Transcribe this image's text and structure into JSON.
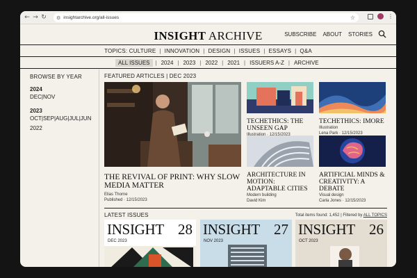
{
  "browser": {
    "url": "insightarchive.org/all-issues"
  },
  "site": {
    "logo_bold": "INSIGHT",
    "logo_rest": "ARCHIVE",
    "nav": [
      "SUBSCRIBE",
      "ABOUT",
      "STORIES"
    ]
  },
  "topics": {
    "label": "TOPICS:",
    "items": [
      "CULTURE",
      "INNOVATION",
      "DESIGN",
      "ISSUES",
      "ESSAYS",
      "Q&A"
    ]
  },
  "filter": {
    "items": [
      "ALL ISSUES",
      "2024",
      "2023",
      "2022",
      "2021",
      "ISSUERS A-Z",
      "ARCHIVE"
    ],
    "active_index": 0
  },
  "sidebar": {
    "heading": "BROWSE BY YEAR",
    "years": [
      {
        "year": "2024",
        "months": [
          "DEC",
          "NOV"
        ]
      },
      {
        "year": "2023",
        "months": [
          "OCT",
          "SEP",
          "AUG",
          "JUL",
          "JUN"
        ]
      },
      {
        "year": "2022",
        "months": []
      }
    ]
  },
  "featured": {
    "heading": "FEATURED ARTICLES | DEC 2023",
    "main": {
      "title": "THE REVIVAL OF PRINT: WHY SLOW MEDIA MATTER",
      "author": "Elias Thorne",
      "meta": "Published · 12/15/2023"
    },
    "cards": [
      {
        "title": "TECHETHICS: THE UNSEEN GAP",
        "category": "Illustration",
        "meta": "Illustration · 12/15/2023"
      },
      {
        "title": "TECHETHICS: IMORE",
        "category": "Illustration",
        "meta": "Lena Park · 12/15/2023"
      },
      {
        "title": "ARCHITECTURE IN MOTION: ADAPTABLE CITIES",
        "category": "Modern building",
        "meta": "David Kim · 12/15/2023"
      },
      {
        "title": "ARTIFICIAL MINDS & CREATIVITY: A DEBATE",
        "category": "Visual design",
        "meta": "Carla Jones · 12/15/2023"
      }
    ]
  },
  "latest": {
    "heading": "LATEST ISSUES",
    "summary_prefix": "Total items found: 1,452 | Filtered by",
    "summary_filter": "ALL TOPICS",
    "issues": [
      {
        "title": "INSIGHT",
        "number": "28",
        "date": "DEC 2023"
      },
      {
        "title": "INSIGHT",
        "number": "27",
        "date": "NOV 2023"
      },
      {
        "title": "INSIGHT",
        "number": "26",
        "date": "OCT 2023"
      }
    ]
  }
}
